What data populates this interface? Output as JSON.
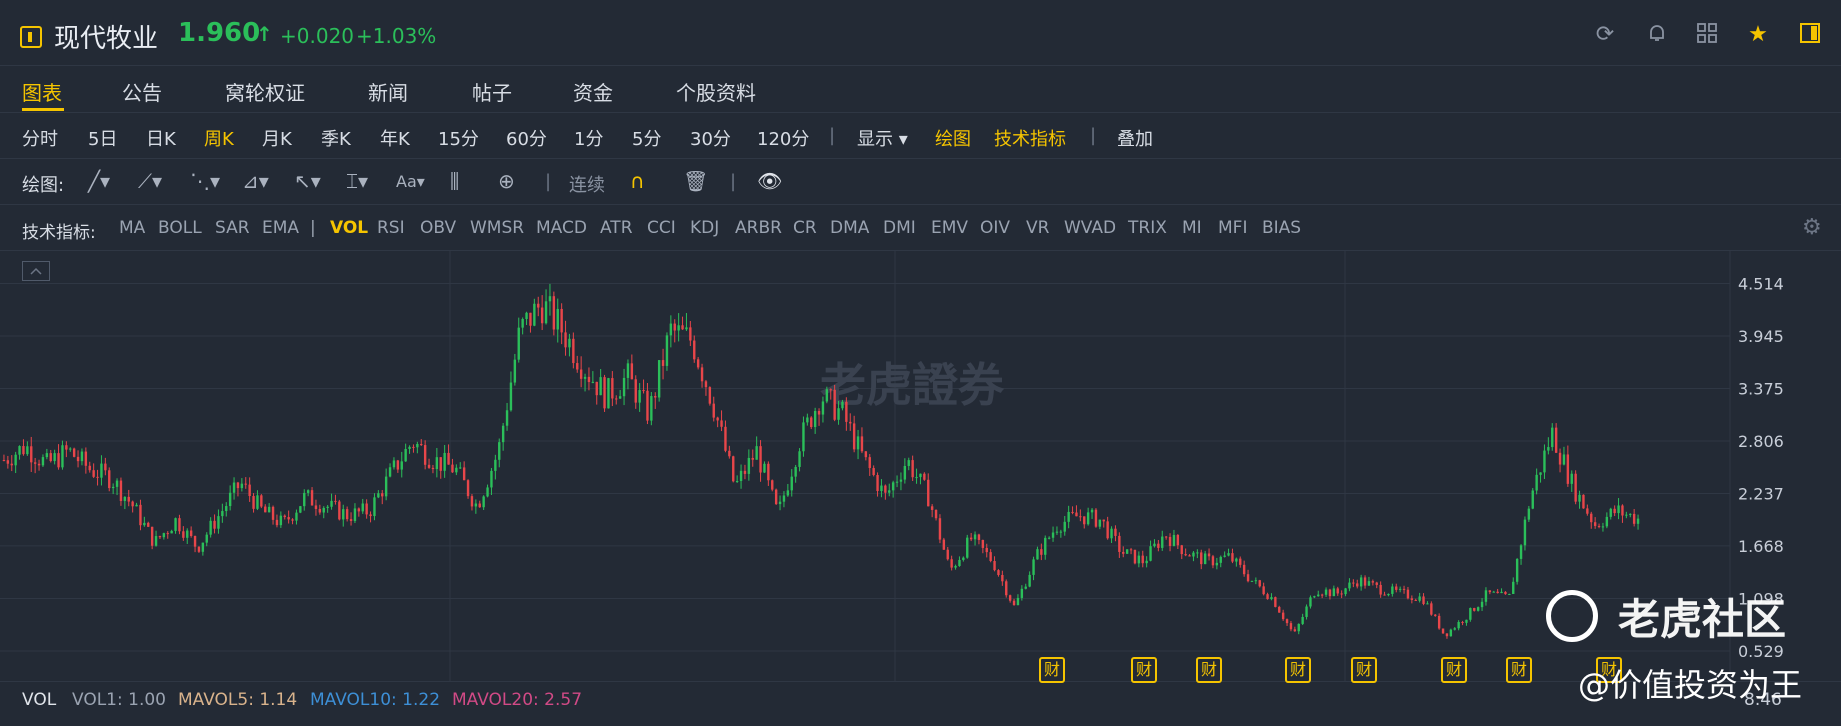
{
  "header": {
    "stock_name": "现代牧业",
    "price": "1.960",
    "arrow": "↑",
    "change": "+0.020",
    "change_pct": "+1.03%",
    "up_color": "#2bbf5a",
    "accent_color": "#f5c400"
  },
  "tabs": [
    {
      "label": "图表",
      "active": true
    },
    {
      "label": "公告"
    },
    {
      "label": "窝轮权证"
    },
    {
      "label": "新闻"
    },
    {
      "label": "帖子"
    },
    {
      "label": "资金"
    },
    {
      "label": "个股资料"
    }
  ],
  "periods": {
    "items": [
      "分时",
      "5日",
      "日K",
      "周K",
      "月K",
      "季K",
      "年K",
      "15分",
      "60分",
      "1分",
      "5分",
      "30分",
      "120分"
    ],
    "active": "周K",
    "display": "显示",
    "draw": "绘图",
    "tech": "技术指标",
    "overlay": "叠加"
  },
  "drawbar": {
    "label": "绘图:",
    "continuous": "连续"
  },
  "indicators": {
    "label": "技术指标:",
    "items": [
      "MA",
      "BOLL",
      "SAR",
      "EMA",
      "|",
      "VOL",
      "RSI",
      "OBV",
      "WMSR",
      "MACD",
      "ATR",
      "CCI",
      "KDJ",
      "ARBR",
      "CR",
      "DMA",
      "DMI",
      "EMV",
      "OIV",
      "VR",
      "WVAD",
      "TRIX",
      "MI",
      "MFI",
      "BIAS"
    ],
    "active": "VOL"
  },
  "chart_data": {
    "type": "candlestick",
    "y_ticks": [
      "4.514",
      "3.945",
      "3.375",
      "2.806",
      "2.237",
      "1.668",
      "1.098",
      "0.529"
    ],
    "ylim": [
      0.42,
      4.65
    ],
    "close_path": [
      2.6,
      2.75,
      2.55,
      2.7,
      2.5,
      2.4,
      2.1,
      1.7,
      1.95,
      1.65,
      2.0,
      2.35,
      2.05,
      1.9,
      2.2,
      2.1,
      2.0,
      2.05,
      2.45,
      2.8,
      2.6,
      2.5,
      2.1,
      2.7,
      4.0,
      4.3,
      4.0,
      3.6,
      3.3,
      3.5,
      3.1,
      4.0,
      3.9,
      3.2,
      2.3,
      2.7,
      2.0,
      2.8,
      3.3,
      3.1,
      2.6,
      2.2,
      2.6,
      2.2,
      1.4,
      1.75,
      1.5,
      1.0,
      1.55,
      1.9,
      2.0,
      1.95,
      1.6,
      1.5,
      1.8,
      1.6,
      1.5,
      1.55,
      1.3,
      1.1,
      0.7,
      1.2,
      1.15,
      1.3,
      1.2,
      1.15,
      1.1,
      0.7,
      0.9,
      1.15,
      1.1,
      2.2,
      2.9,
      2.3,
      1.9,
      2.05,
      1.96
    ],
    "vol_label": "VOL",
    "vol1": "VOL1: 1.00",
    "mavol5": "MAVOL5: 1.14",
    "mavol10": "MAVOL10: 1.22",
    "mavol20": "MAVOL20: 2.57",
    "vol_tick": "8.46",
    "event_marker": "财"
  },
  "watermark": {
    "brand": "老虎社区",
    "chart_brand": "老虎證券",
    "user": "@价值投资为王"
  },
  "colors": {
    "background": "#232a35",
    "up": "#2bbf5a",
    "down": "#e8464a",
    "mavol5": "#d9b38c",
    "mavol10": "#3d8fd6",
    "mavol20": "#d14a86"
  }
}
